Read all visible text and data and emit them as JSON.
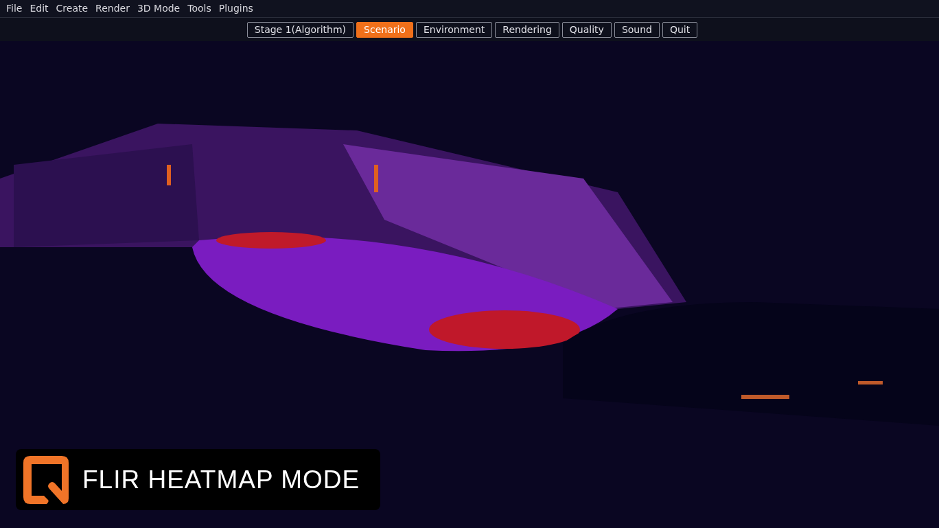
{
  "menu": [
    "File",
    "Edit",
    "Create",
    "Render",
    "3D Mode",
    "Tools",
    "Plugins"
  ],
  "tabs": [
    {
      "label": "Stage 1(Algorithm)",
      "selected": false
    },
    {
      "label": "Scenario",
      "selected": true
    },
    {
      "label": "Environment",
      "selected": false
    },
    {
      "label": "Rendering",
      "selected": false
    },
    {
      "label": "Quality",
      "selected": false
    },
    {
      "label": "Sound",
      "selected": false
    },
    {
      "label": "Quit",
      "selected": false
    }
  ],
  "mode_badge": {
    "label": "FLIR HEATMAP MODE"
  }
}
